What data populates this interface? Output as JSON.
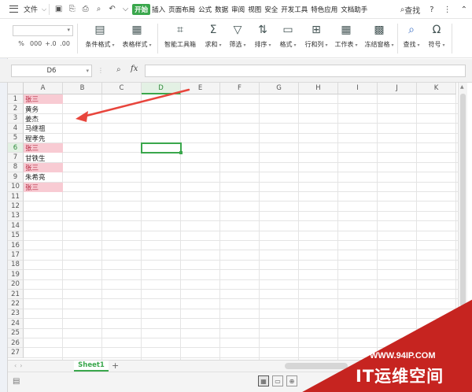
{
  "menubar": {
    "file_label": "文件",
    "tabs": [
      {
        "label": "开始",
        "active": true
      },
      {
        "label": "插入"
      },
      {
        "label": "页面布局"
      },
      {
        "label": "公式"
      },
      {
        "label": "数据"
      },
      {
        "label": "审阅"
      },
      {
        "label": "视图"
      },
      {
        "label": "安全"
      },
      {
        "label": "开发工具"
      },
      {
        "label": "特色应用"
      },
      {
        "label": "文档助手"
      }
    ],
    "search_label": "查找",
    "help_label": "?"
  },
  "ribbon": {
    "number_format_value": "",
    "num_buttons": [
      "%",
      "000",
      "+.0",
      ".00"
    ],
    "buttons": [
      {
        "label": "条件格式",
        "icon": "conditional-format-icon"
      },
      {
        "label": "表格样式",
        "icon": "table-style-icon"
      },
      {
        "label": "智能工具箱",
        "icon": "smart-toolbox-icon"
      },
      {
        "label": "求和",
        "icon": "sum-icon"
      },
      {
        "label": "筛选",
        "icon": "filter-icon"
      },
      {
        "label": "排序",
        "icon": "sort-icon"
      },
      {
        "label": "格式",
        "icon": "format-icon"
      },
      {
        "label": "行和列",
        "icon": "row-col-icon"
      },
      {
        "label": "工作表",
        "icon": "worksheet-icon"
      },
      {
        "label": "冻结窗格",
        "icon": "freeze-icon"
      },
      {
        "label": "查找",
        "icon": "find-icon"
      },
      {
        "label": "符号",
        "icon": "symbol-icon"
      }
    ]
  },
  "formula": {
    "name_box": "D6",
    "fx_label": "fx",
    "value": ""
  },
  "sheet": {
    "columns": [
      "A",
      "B",
      "C",
      "D",
      "E",
      "F",
      "G",
      "H",
      "I",
      "J",
      "K"
    ],
    "selected_column": "D",
    "selected_row": 6,
    "rows": [
      "1",
      "2",
      "3",
      "4",
      "5",
      "6",
      "7",
      "8",
      "9",
      "10",
      "11",
      "12",
      "13",
      "14",
      "15",
      "16",
      "17",
      "18",
      "19",
      "20",
      "21",
      "22",
      "23",
      "24",
      "25",
      "26",
      "27"
    ],
    "column_a": [
      {
        "text": "张三",
        "highlight": true
      },
      {
        "text": "黄务",
        "highlight": false
      },
      {
        "text": "姜杰",
        "highlight": false
      },
      {
        "text": "马继祖",
        "highlight": false
      },
      {
        "text": "程孝先",
        "highlight": false
      },
      {
        "text": "张三",
        "highlight": true
      },
      {
        "text": "甘铁生",
        "highlight": false
      },
      {
        "text": "张三",
        "highlight": true
      },
      {
        "text": "朱希亮",
        "highlight": false
      },
      {
        "text": "张三",
        "highlight": true
      }
    ],
    "highlight_color": "#f8cbd3",
    "highlight_text_color": "#b4243c"
  },
  "tabs": {
    "sheet_name": "Sheet1",
    "add_label": "+"
  },
  "watermark": {
    "url": "WWW.94IP.COM",
    "brand": "IT运维空间",
    "color": "#c62420"
  },
  "accent_color": "#3aa74c"
}
